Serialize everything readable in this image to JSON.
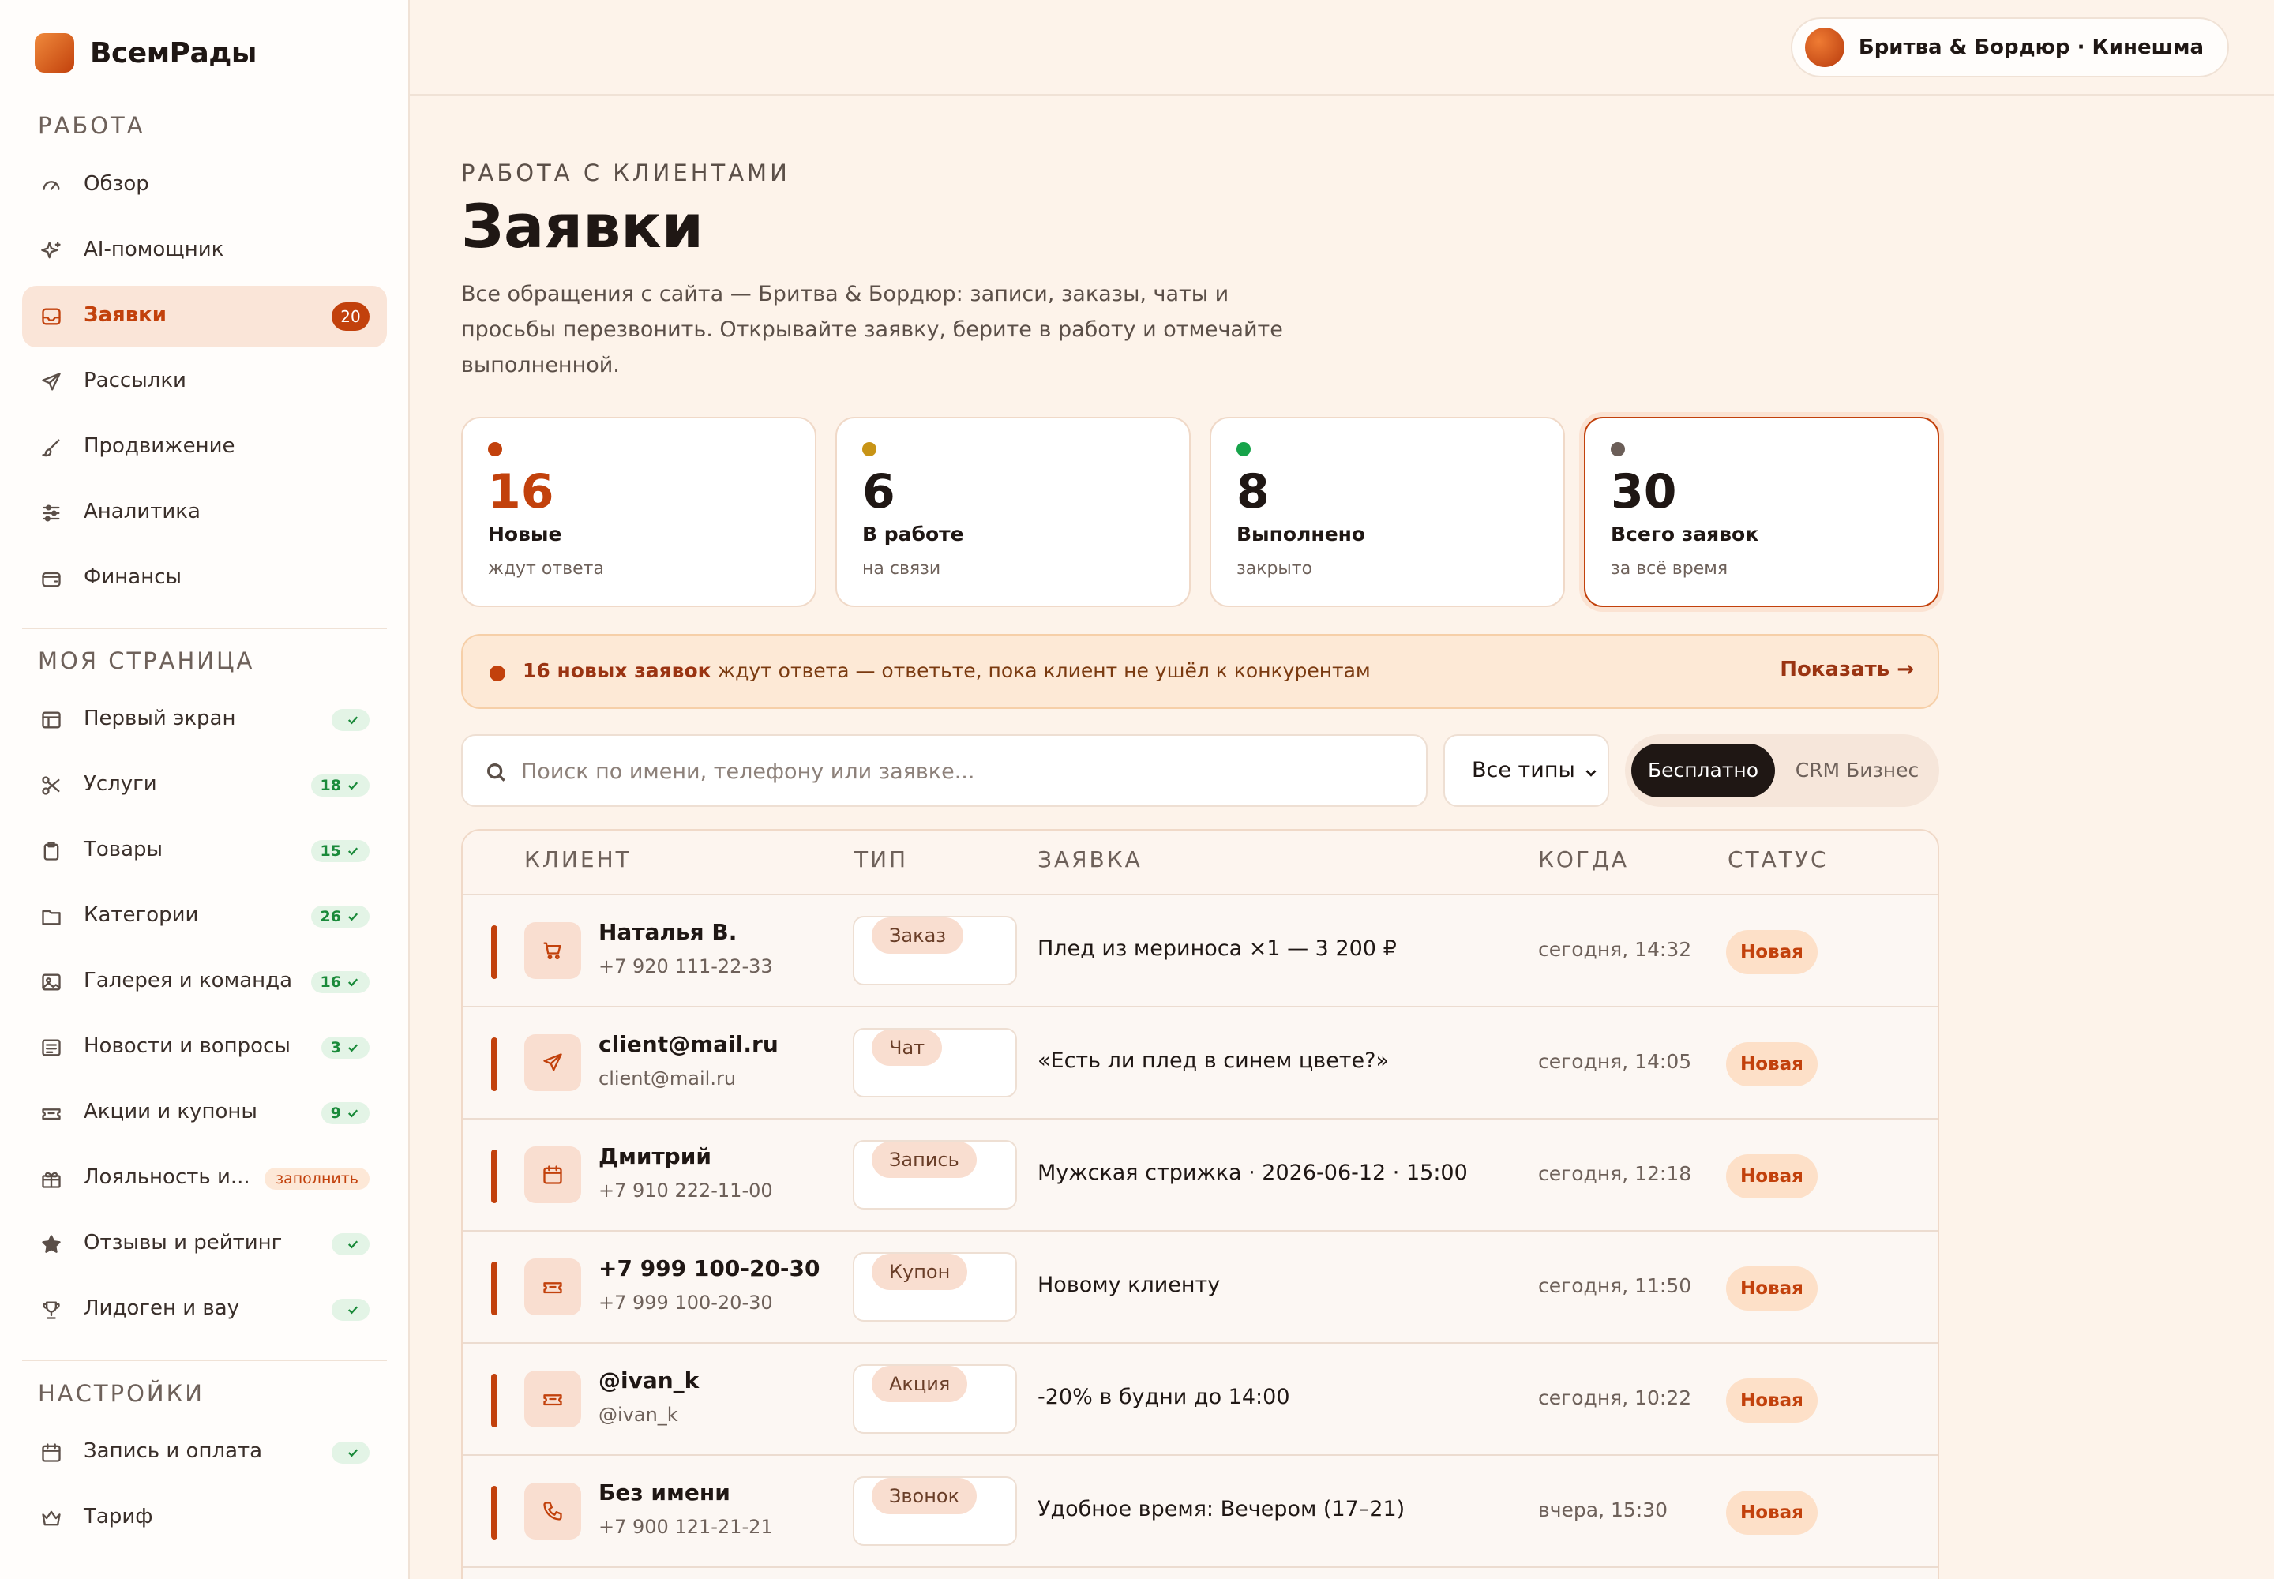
{
  "app": {
    "name": "ВсемРады"
  },
  "sidebar": {
    "sections": [
      {
        "title": "РАБОТА"
      },
      {
        "title": "МОЯ СТРАНИЦА"
      },
      {
        "title": "НАСТРОЙКИ"
      }
    ],
    "work": [
      {
        "label": "Обзор",
        "icon": "gauge-icon"
      },
      {
        "label": "AI-помощник",
        "icon": "sparkles-icon"
      },
      {
        "label": "Заявки",
        "icon": "inbox-icon",
        "count": "20",
        "active": true
      },
      {
        "label": "Рассылки",
        "icon": "send-icon"
      },
      {
        "label": "Продвижение",
        "icon": "brush-icon"
      },
      {
        "label": "Аналитика",
        "icon": "sliders-icon"
      },
      {
        "label": "Финансы",
        "icon": "wallet-icon"
      }
    ],
    "page": [
      {
        "label": "Первый экран",
        "icon": "layout-icon",
        "check": ""
      },
      {
        "label": "Услуги",
        "icon": "scissors-icon",
        "check": "18"
      },
      {
        "label": "Товары",
        "icon": "clipboard-icon",
        "check": "15"
      },
      {
        "label": "Категории",
        "icon": "folder-icon",
        "check": "26"
      },
      {
        "label": "Галерея и команда",
        "icon": "image-icon",
        "check": "16"
      },
      {
        "label": "Новости и вопросы",
        "icon": "news-icon",
        "check": "3"
      },
      {
        "label": "Акции и купоны",
        "icon": "ticket-icon",
        "check": "9"
      },
      {
        "label": "Лояльность и...",
        "icon": "gift-icon",
        "fill": "заполнить"
      },
      {
        "label": "Отзывы и рейтинг",
        "icon": "star-icon",
        "check": ""
      },
      {
        "label": "Лидоген и вау",
        "icon": "trophy-icon",
        "check": ""
      }
    ],
    "settings": [
      {
        "label": "Запись и оплата",
        "icon": "calendar-icon",
        "check": ""
      },
      {
        "label": "Тариф",
        "icon": "crown-icon"
      }
    ]
  },
  "header": {
    "store": "Бритва & Бордюр · Кинешма"
  },
  "main": {
    "kicker": "РАБОТА С КЛИЕНТАМИ",
    "title": "Заявки",
    "description": "Все обращения с сайта — Бритва & Бордюр: записи, заказы, чаты и просьбы перезвонить. Открывайте заявку, берите в работу и отмечайте выполненной.",
    "stats": [
      {
        "num": "16",
        "label": "Новые",
        "sub": "ждут ответа",
        "color": "#c2410c"
      },
      {
        "num": "6",
        "label": "В работе",
        "sub": "на связи",
        "color": "#c89416"
      },
      {
        "num": "8",
        "label": "Выполнено",
        "sub": "закрыто",
        "color": "#16a34a"
      },
      {
        "num": "30",
        "label": "Всего заявок",
        "sub": "за всё время",
        "color": "#6b5e58"
      }
    ],
    "alert": {
      "bold": "16 новых заявок",
      "text": " ждут ответа — ответьте, пока клиент не ушёл к конкурентам",
      "action": "Показать →"
    },
    "search": {
      "placeholder": "Поиск по имени, телефону или заявке..."
    },
    "type_filter": "Все типы",
    "plans": {
      "active": "Бесплатно",
      "other": "CRM Бизнес"
    },
    "table": {
      "headers": {
        "client": "КЛИЕНТ",
        "type": "ТИП",
        "request": "ЗАЯВКА",
        "when": "КОГДА",
        "status": "СТАТУС"
      },
      "rows": [
        {
          "name": "Наталья В.",
          "contact": "+7 920 111-22-33",
          "type": "Заказ",
          "icon": "cart-icon",
          "request": "Плед из мериноса ×1 — 3 200 ₽",
          "when": "сегодня, 14:32",
          "status": "Новая"
        },
        {
          "name": "client@mail.ru",
          "contact": "client@mail.ru",
          "type": "Чат",
          "icon": "send-icon",
          "request": "«Есть ли плед в синем цвете?»",
          "when": "сегодня, 14:05",
          "status": "Новая"
        },
        {
          "name": "Дмитрий",
          "contact": "+7 910 222-11-00",
          "type": "Запись",
          "icon": "calendar-icon",
          "request": "Мужская стрижка · 2026-06-12 · 15:00",
          "when": "сегодня, 12:18",
          "status": "Новая"
        },
        {
          "name": "+7 999 100-20-30",
          "contact": "+7 999 100-20-30",
          "type": "Купон",
          "icon": "ticket-icon",
          "request": "Новому клиенту",
          "when": "сегодня, 11:50",
          "status": "Новая"
        },
        {
          "name": "@ivan_k",
          "contact": "@ivan_k",
          "type": "Акция",
          "icon": "ticket-icon",
          "request": "-20% в будни до 14:00",
          "when": "сегодня, 10:22",
          "status": "Новая"
        },
        {
          "name": "Без имени",
          "contact": "+7 900 121-21-21",
          "type": "Звонок",
          "icon": "phone-icon",
          "request": "Удобное время: Вечером (17–21)",
          "when": "вчера, 15:30",
          "status": "Новая"
        }
      ]
    }
  }
}
